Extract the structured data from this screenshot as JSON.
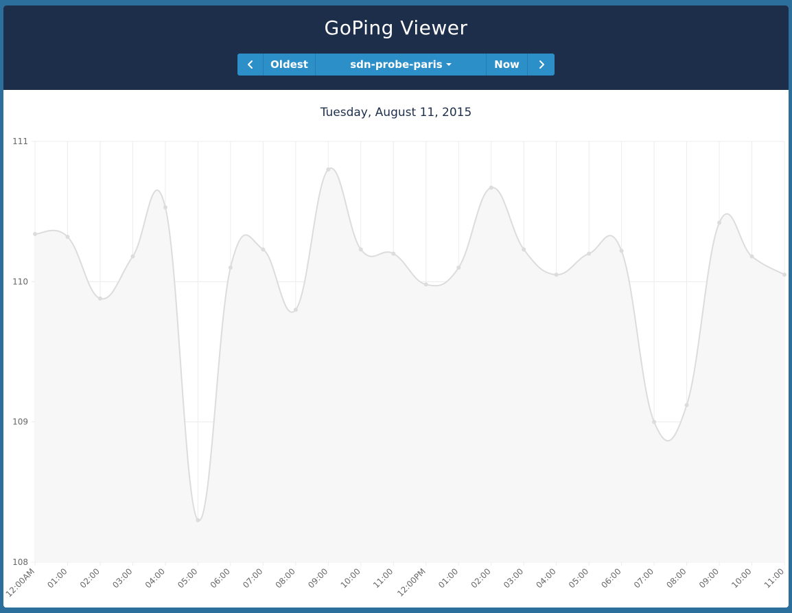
{
  "header": {
    "title": "GoPing Viewer",
    "toolbar": {
      "prev_icon": "chevron-left-icon",
      "oldest_label": "Oldest",
      "probe_label": "sdn-probe-paris",
      "dropdown_icon": "caret-down-icon",
      "now_label": "Now",
      "next_icon": "chevron-right-icon"
    }
  },
  "colors": {
    "page_background": "#2c6f9c",
    "header_background": "#1c2e4a",
    "button": "#2d8fc8",
    "line": "#dcdcdc",
    "fill": "#f7f7f7"
  },
  "chart_data": {
    "type": "line",
    "title": "Tuesday, August 11, 2015",
    "categories": [
      "12:00AM",
      "01:00",
      "02:00",
      "03:00",
      "04:00",
      "05:00",
      "06:00",
      "07:00",
      "08:00",
      "09:00",
      "10:00",
      "11:00",
      "12:00PM",
      "01:00",
      "02:00",
      "03:00",
      "04:00",
      "05:00",
      "06:00",
      "07:00",
      "08:00",
      "09:00",
      "10:00",
      "11:00"
    ],
    "values": [
      110.34,
      110.32,
      109.88,
      110.18,
      110.53,
      108.3,
      110.1,
      110.23,
      109.8,
      110.8,
      110.23,
      110.2,
      109.98,
      110.1,
      110.67,
      110.23,
      110.05,
      110.2,
      110.22,
      109.0,
      109.12,
      110.42,
      110.18,
      110.05
    ],
    "ylim": [
      108,
      111
    ],
    "yticks": [
      108,
      109,
      110,
      111
    ],
    "grid": true,
    "area_fill": true,
    "smooth": true
  }
}
